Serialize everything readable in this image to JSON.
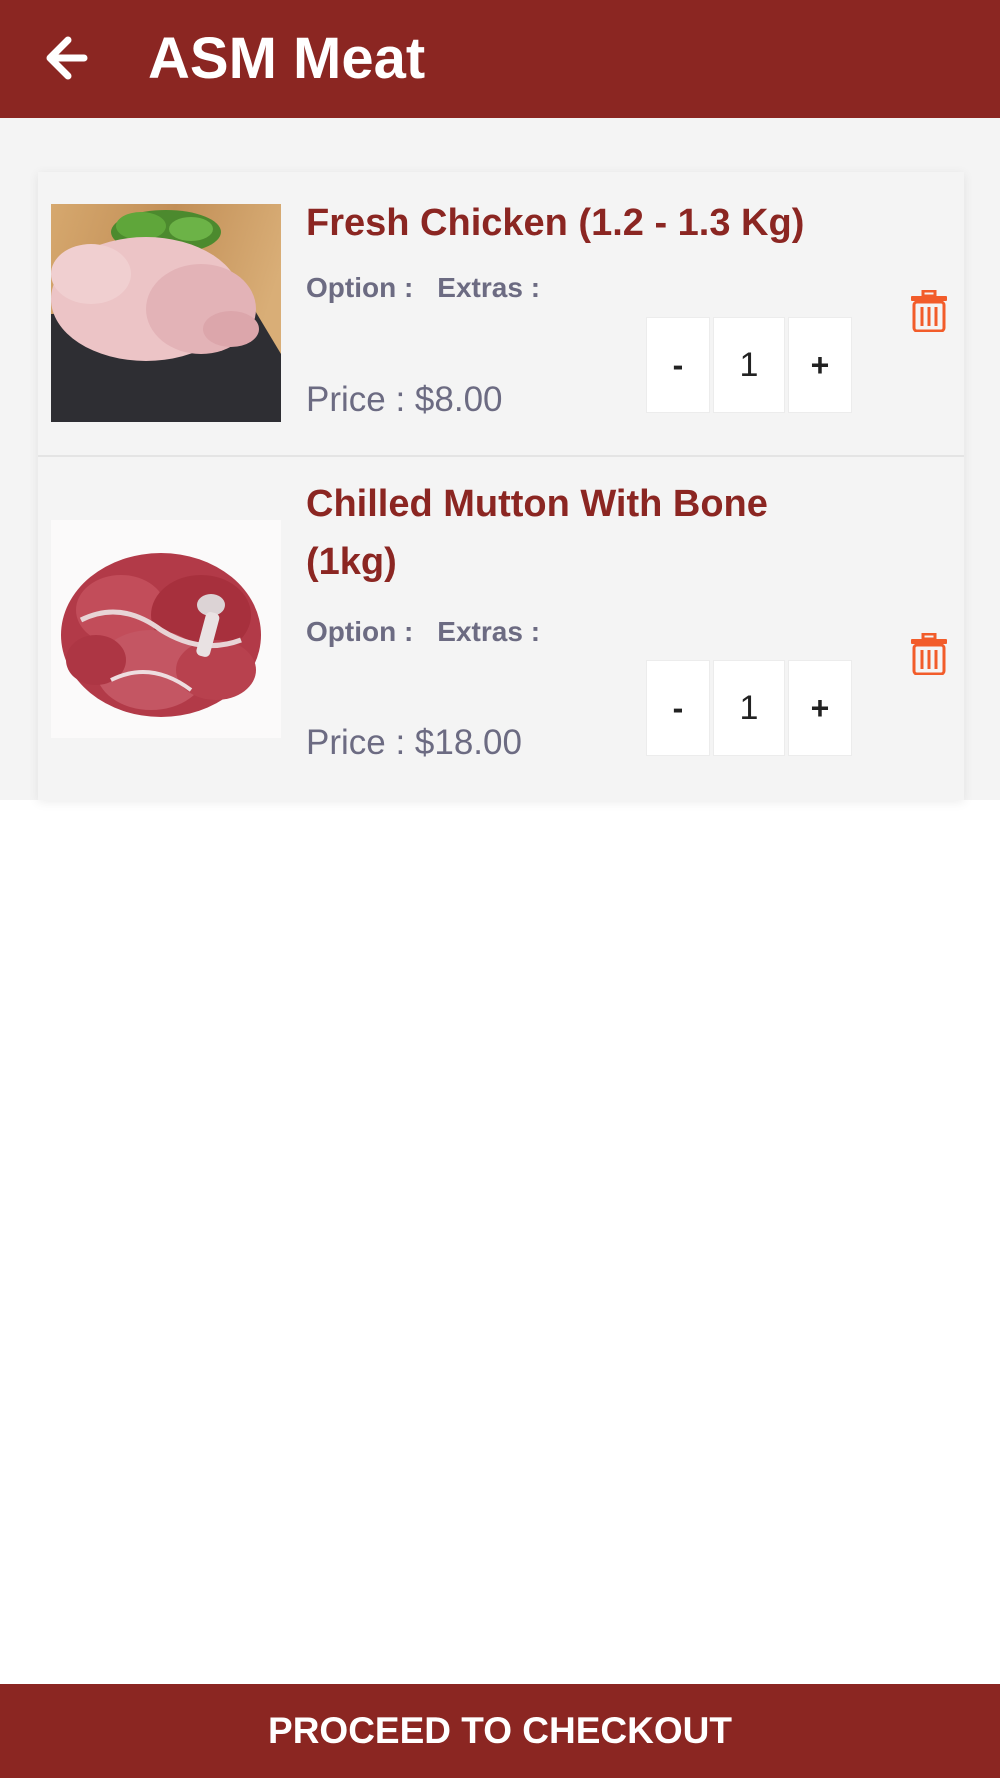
{
  "header": {
    "back_icon": "back-arrow-icon",
    "title": "ASM Meat",
    "background": "#8b2622"
  },
  "cart": {
    "items": [
      {
        "name": "Fresh Chicken (1.2 - 1.3 Kg)",
        "option_label": "Option :",
        "extras_label": "Extras :",
        "price": "Price : $8.00",
        "quantity": "1",
        "minus_label": "-",
        "plus_label": "+",
        "image": "whole-chicken-image",
        "delete_icon": "trash-icon"
      },
      {
        "name": "Chilled Mutton With Bone (1kg)",
        "option_label": "Option :",
        "extras_label": "Extras :",
        "price": "Price : $18.00",
        "quantity": "1",
        "minus_label": "-",
        "plus_label": "+",
        "image": "mutton-pieces-image",
        "delete_icon": "trash-icon"
      }
    ]
  },
  "footer": {
    "checkout_label": "PROCEED TO CHECKOUT"
  },
  "colors": {
    "brand": "#8b2622",
    "muted_text": "#6c6b82",
    "trash": "#f25c2a"
  }
}
